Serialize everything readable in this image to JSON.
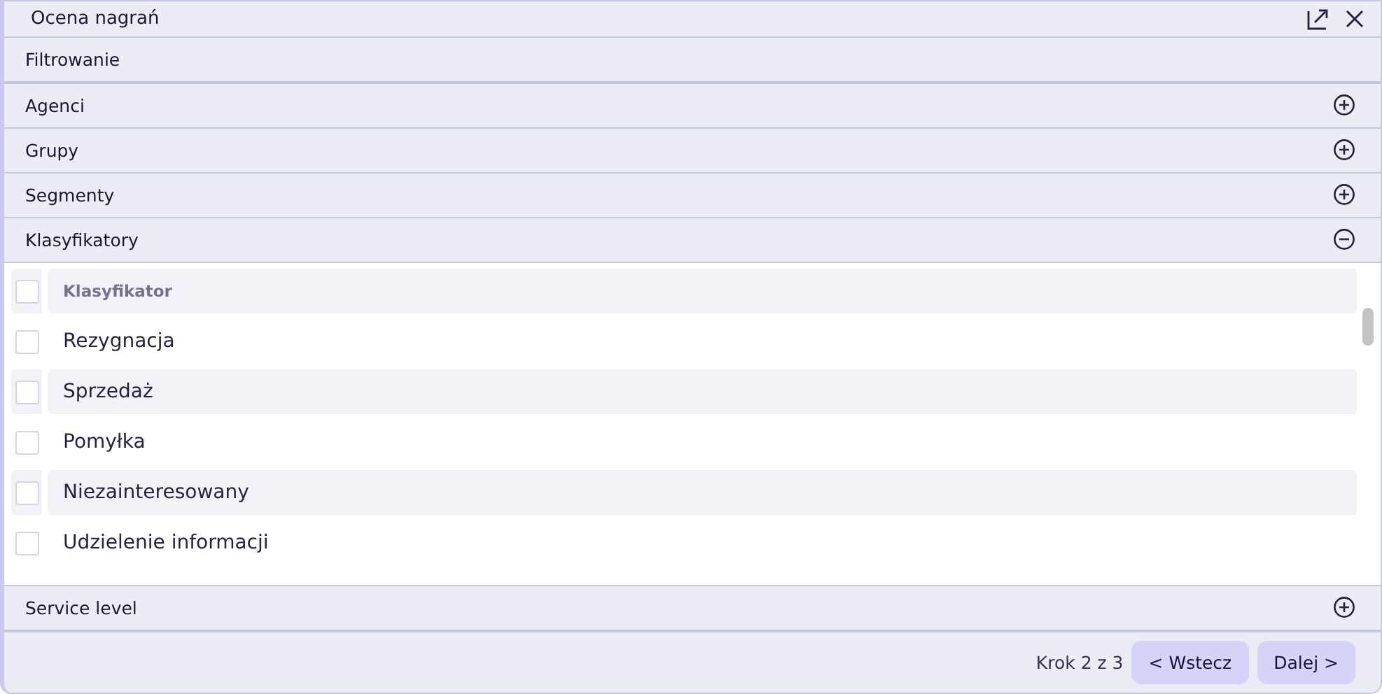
{
  "window": {
    "title": "Ocena nagrań"
  },
  "filter_header": "Filtrowanie",
  "sections_before": [
    {
      "label": "Agenci",
      "expanded": false
    },
    {
      "label": "Grupy",
      "expanded": false
    },
    {
      "label": "Segmenty",
      "expanded": false
    },
    {
      "label": "Klasyfikatory",
      "expanded": true
    }
  ],
  "table": {
    "header": {
      "label": "Klasyfikator",
      "checked": false
    },
    "rows": [
      {
        "label": "Rezygnacja",
        "checked": false
      },
      {
        "label": "Sprzedaż",
        "checked": false
      },
      {
        "label": "Pomyłka",
        "checked": false
      },
      {
        "label": "Niezainteresowany",
        "checked": false
      },
      {
        "label": "Udzielenie informacji",
        "checked": false
      }
    ]
  },
  "sections_after": [
    {
      "label": "Service level",
      "expanded": false
    }
  ],
  "footer": {
    "step": "Krok 2 z 3",
    "back": "< Wstecz",
    "next": "Dalej >"
  }
}
